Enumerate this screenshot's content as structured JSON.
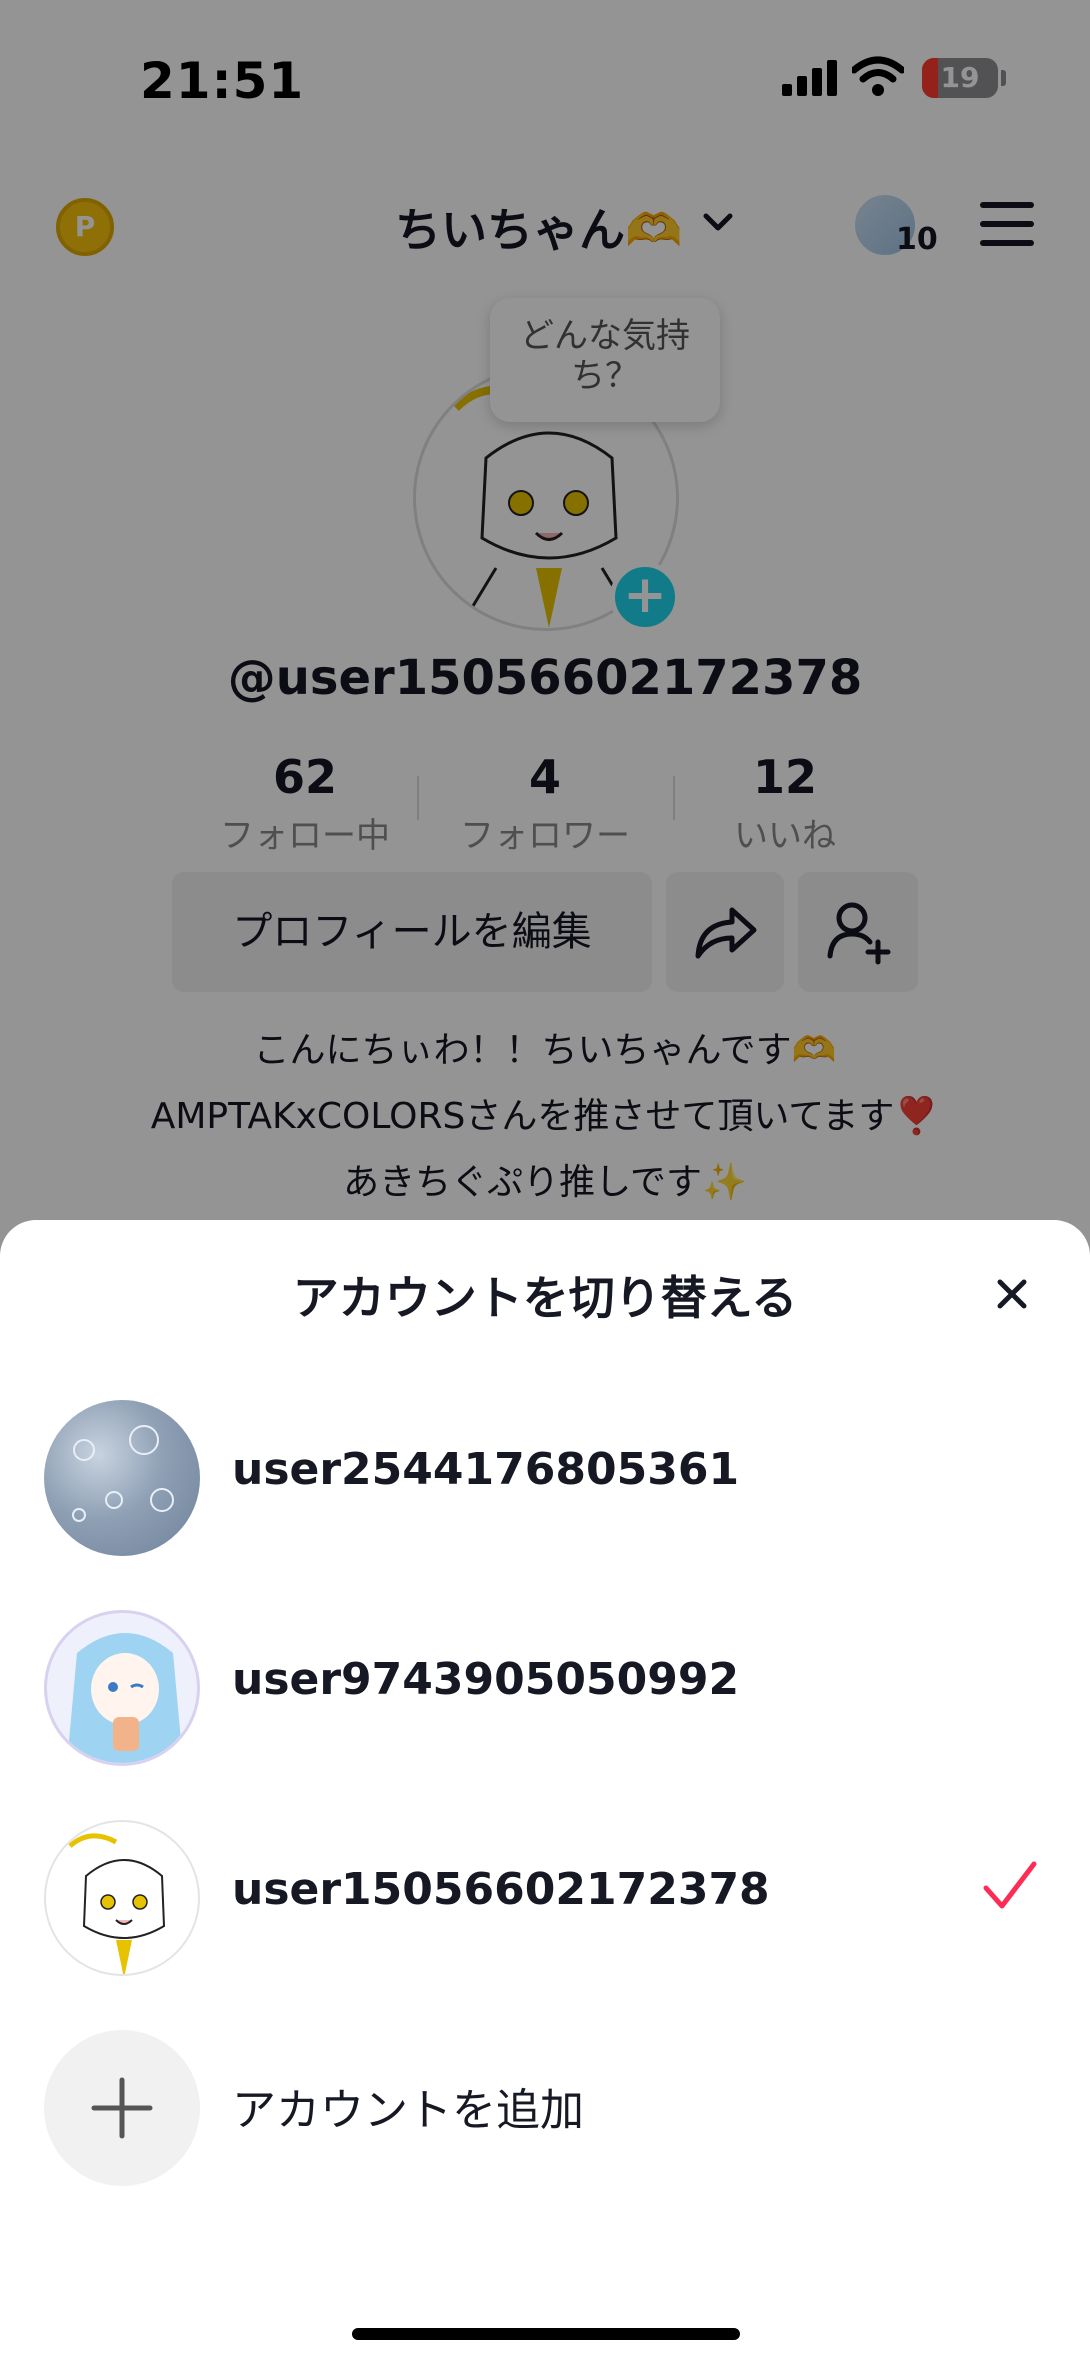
{
  "status_bar": {
    "time": "21:51",
    "battery": "19"
  },
  "header": {
    "title": "ちいちゃん🫶",
    "avatar_count": "10",
    "coin_glyph": "P"
  },
  "profile": {
    "mood_prompt": "どんな気持ち？",
    "handle": "@user15056602172378",
    "stats": [
      {
        "value": "62",
        "label": "フォロー中"
      },
      {
        "value": "4",
        "label": "フォロワー"
      },
      {
        "value": "12",
        "label": "いいね"
      }
    ],
    "edit_label": "プロフィールを編集",
    "bio": [
      "こんにちぃわ！！ちいちゃんです🫶",
      "AMPTAKxCOLORSさんを推させて頂いてます❣️",
      "あきちぐぷり推しです✨"
    ]
  },
  "switch_sheet": {
    "title": "アカウントを切り替える",
    "accounts": [
      {
        "name": "user2544176805361",
        "selected": false,
        "avatar": "bubbles-photo"
      },
      {
        "name": "user9743905050992",
        "selected": false,
        "avatar": "blue-hair-girl"
      },
      {
        "name": "user15056602172378",
        "selected": true,
        "avatar": "sketch-character"
      }
    ],
    "add_label": "アカウントを追加"
  },
  "colors": {
    "accent": "#fe2c55",
    "teal": "#20d5ec",
    "coin": "#f4c20d"
  }
}
